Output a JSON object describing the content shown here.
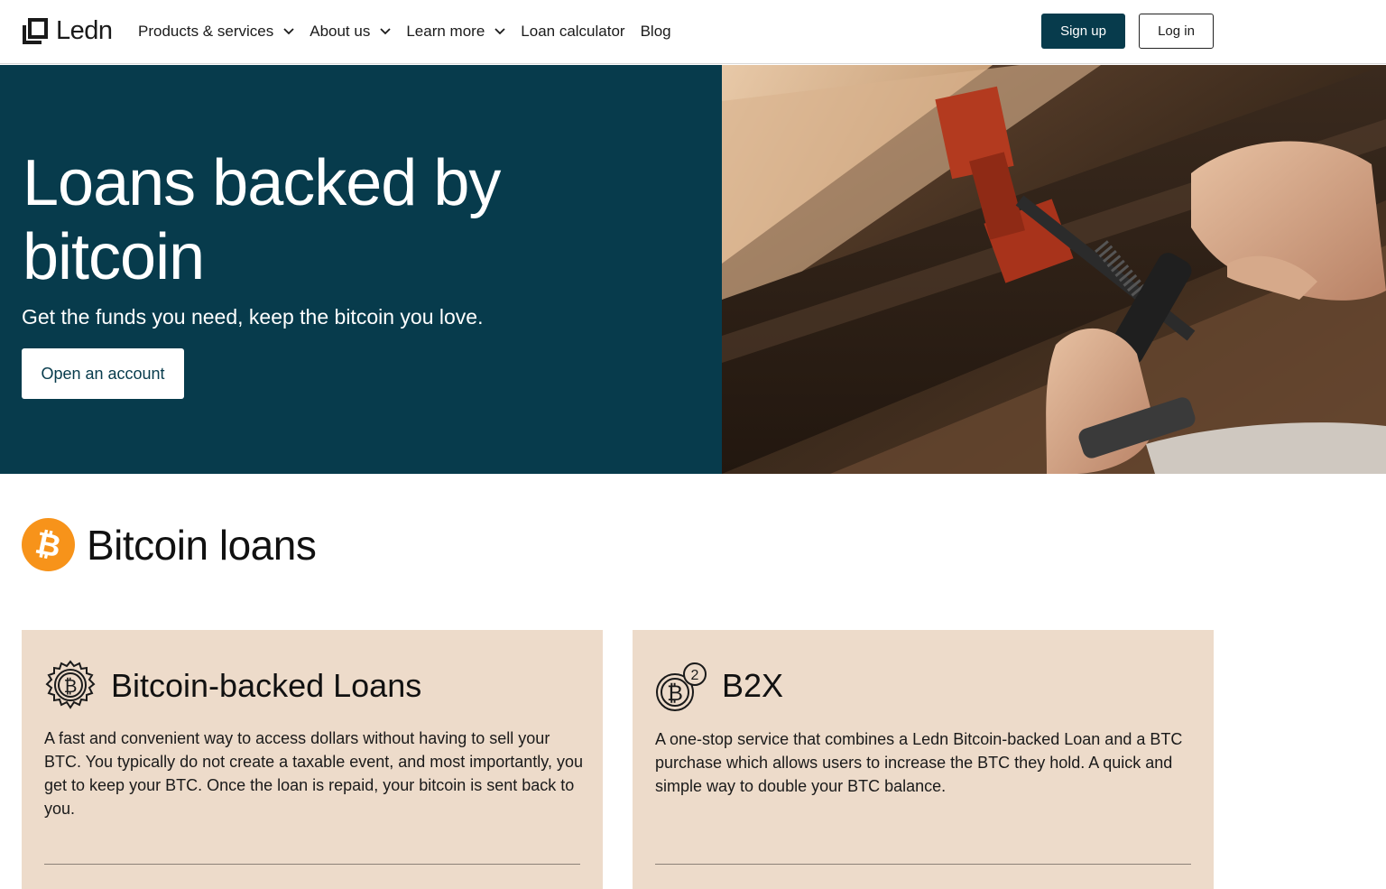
{
  "nav": {
    "logo_text": "Ledn",
    "menu": [
      {
        "label": "Products & services",
        "dropdown": true
      },
      {
        "label": "About us",
        "dropdown": true
      },
      {
        "label": "Learn more",
        "dropdown": true
      },
      {
        "label": "Loan calculator",
        "dropdown": false
      },
      {
        "label": "Blog",
        "dropdown": false
      }
    ],
    "signup_label": "Sign up",
    "login_label": "Log in"
  },
  "hero": {
    "title": "Loans backed by bitcoin",
    "subtitle": "Get the funds you need, keep the bitcoin you love.",
    "cta_label": "Open an account",
    "image_icon": "workshop-clamp-photo"
  },
  "section": {
    "title": "Bitcoin loans",
    "icon": "bitcoin-badge-icon"
  },
  "cards": [
    {
      "title": "Bitcoin-backed Loans",
      "icon": "bitcoin-gear-icon",
      "text": "A fast and convenient way to access dollars without having to sell your BTC. You typically do not create a taxable event, and most importantly, you get to keep your BTC. Once the loan is repaid, your bitcoin is sent back to you."
    },
    {
      "title": "B2X",
      "icon": "bitcoin-double-icon",
      "badge": "2",
      "text": "A one-stop service that combines a Ledn Bitcoin-backed Loan and a BTC purchase which allows users to increase the BTC they hold. A quick and simple way to double your BTC balance."
    }
  ],
  "colors": {
    "brand_dark": "#073b4c",
    "bitcoin_orange": "#f7931a",
    "card_bg": "#eddbca"
  }
}
